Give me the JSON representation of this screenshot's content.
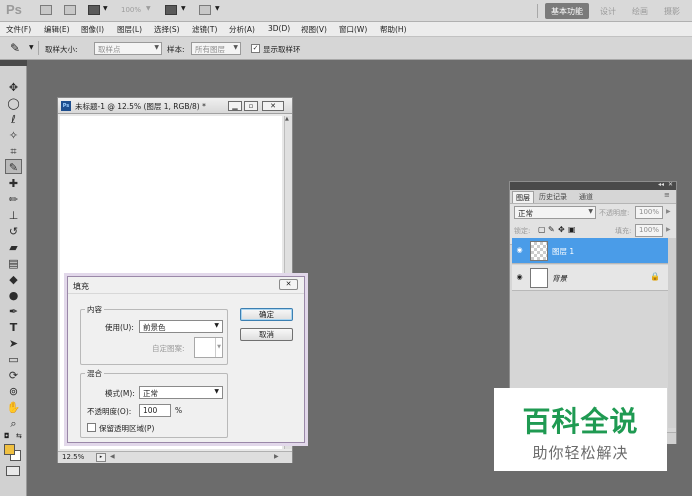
{
  "app": {
    "logo": "Ps",
    "zoom": "100%",
    "workspaces": [
      "基本功能",
      "设计",
      "绘画",
      "摄影"
    ]
  },
  "menubar": {
    "items": [
      "文件(F)",
      "编辑(E)",
      "图像(I)",
      "图层(L)",
      "选择(S)",
      "滤镜(T)",
      "分析(A)",
      "3D(D)",
      "视图(V)",
      "窗口(W)",
      "帮助(H)"
    ]
  },
  "options": {
    "sample_size_label": "取样大小:",
    "sample_size_value": "取样点",
    "sample_label": "样本:",
    "sample_value": "所有图层",
    "show_ring_label": "显示取样环",
    "show_ring_checked": true
  },
  "tools": [
    "move-tool",
    "marquee-tool",
    "lasso-tool",
    "quick-select-tool",
    "crop-tool",
    "eyedropper-tool",
    "healing-tool",
    "brush-tool",
    "clone-stamp-tool",
    "history-brush-tool",
    "eraser-tool",
    "gradient-tool",
    "blur-tool",
    "dodge-tool",
    "pen-tool",
    "type-tool",
    "path-select-tool",
    "shape-tool",
    "3d-rotate-tool",
    "3d-orbit-tool",
    "hand-tool",
    "zoom-tool"
  ],
  "colors": {
    "foreground": "#f0c040",
    "background": "#ffffff",
    "selection": "#4a9ce8"
  },
  "document": {
    "title": "未标题-1 @ 12.5% (图层 1, RGB/8) *",
    "zoom": "12.5%",
    "scroll_left": "◀",
    "scroll_right": "▶"
  },
  "fill_dialog": {
    "title": "填充",
    "content_group": "内容",
    "use_label": "使用(U):",
    "use_value": "前景色",
    "custom_pattern_label": "自定图案:",
    "blend_group": "混合",
    "mode_label": "模式(M):",
    "mode_value": "正常",
    "opacity_label": "不透明度(O):",
    "opacity_value": "100",
    "opacity_unit": "%",
    "preserve_label": "保留透明区域(P)",
    "preserve_checked": false,
    "ok": "确定",
    "cancel": "取消"
  },
  "layers_panel": {
    "tabs": [
      "图层",
      "历史记录",
      "通道"
    ],
    "blend_mode": "正常",
    "opacity_label": "不透明度:",
    "opacity_value": "100%",
    "lock_label": "锁定:",
    "fill_label": "填充:",
    "fill_value": "100%",
    "layers": [
      {
        "name": "图层 1",
        "selected": true,
        "locked": false
      },
      {
        "name": "背景",
        "selected": false,
        "locked": true
      }
    ]
  },
  "watermark": {
    "title": "百科全说",
    "subtitle": "助你轻松解决"
  }
}
